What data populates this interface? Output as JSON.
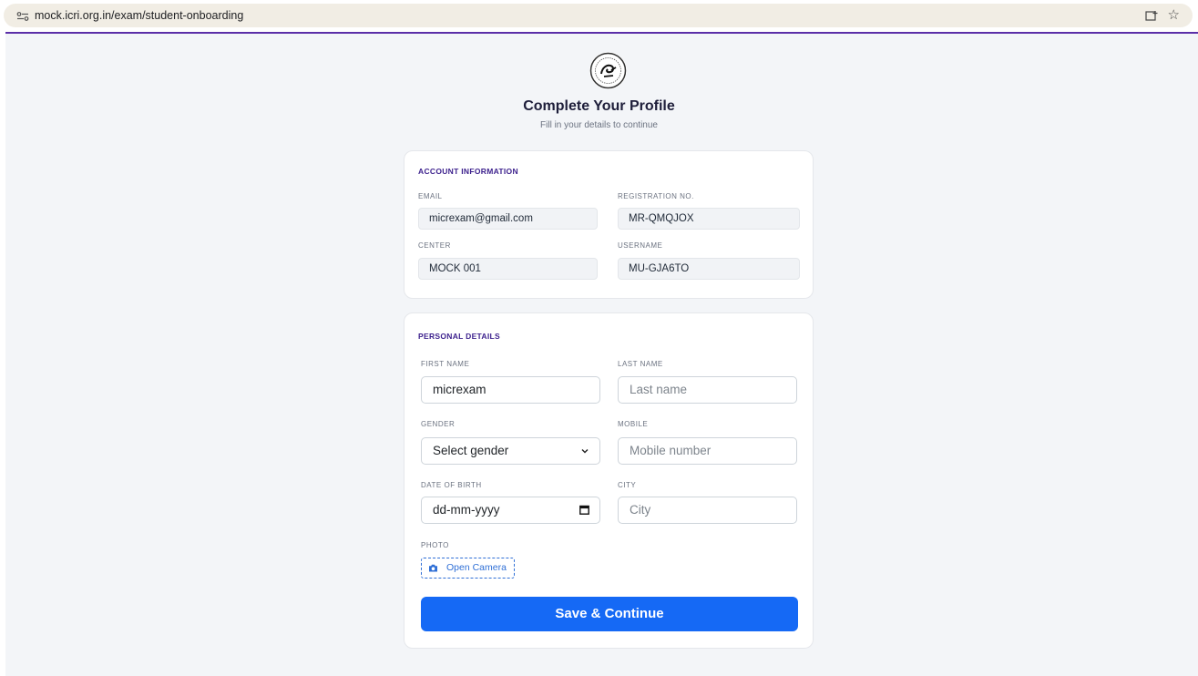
{
  "browser": {
    "url": "mock.icri.org.in/exam/student-onboarding"
  },
  "header": {
    "title": "Complete Your Profile",
    "subtitle": "Fill in your details to continue"
  },
  "account": {
    "section_title": "ACCOUNT INFORMATION",
    "email_label": "EMAIL",
    "email_value": "micrexam@gmail.com",
    "registration_label": "REGISTRATION NO.",
    "registration_value": "MR-QMQJOX",
    "center_label": "CENTER",
    "center_value": "MOCK 001",
    "username_label": "USERNAME",
    "username_value": "MU-GJA6TO"
  },
  "personal": {
    "section_title": "PERSONAL DETAILS",
    "first_name_label": "FIRST NAME",
    "first_name_value": "micrexam",
    "last_name_label": "LAST NAME",
    "last_name_placeholder": "Last name",
    "gender_label": "GENDER",
    "gender_selected": "Select gender",
    "mobile_label": "MOBILE",
    "mobile_placeholder": "Mobile number",
    "dob_label": "DATE OF BIRTH",
    "dob_placeholder": "dd-mm-yyyy",
    "city_label": "CITY",
    "city_placeholder": "City",
    "photo_label": "PHOTO",
    "camera_button": "Open Camera",
    "save_button": "Save & Continue"
  },
  "colors": {
    "accent_purple": "#3b1f8c",
    "primary_blue": "#1569f5",
    "page_bg": "#f3f5f8"
  }
}
